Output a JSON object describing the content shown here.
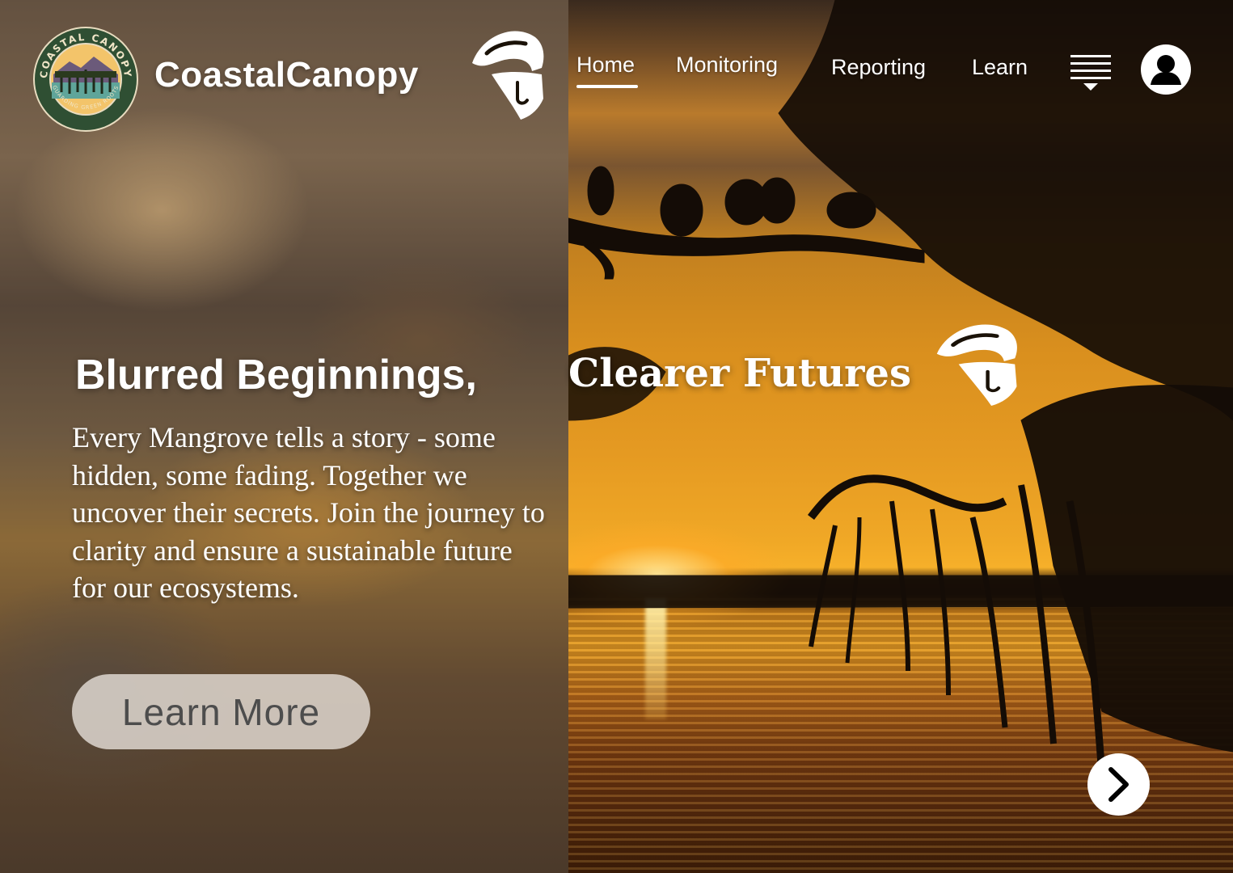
{
  "brand": {
    "name": "CoastalCanopy",
    "badge_top_text": "COASTAL CANOPY",
    "badge_bottom_text": "GUARDING GREEN ROOTS"
  },
  "nav": {
    "items": [
      {
        "label": "Home",
        "active": true
      },
      {
        "label": "Monitoring",
        "active": false
      },
      {
        "label": "Reporting",
        "active": false
      },
      {
        "label": "Learn",
        "active": false
      }
    ],
    "menu_icon": "hamburger-menu-icon",
    "profile_icon": "user-profile-icon"
  },
  "hero": {
    "title_left": "Blurred Beginnings,",
    "title_right": "Clearer Futures",
    "body": "Every Mangrove tells a story - some hidden, some fading. Together we uncover their secrets. Join the journey to clarity and ensure a sustainable future for our ecosystems.",
    "cta_label": "Learn More",
    "next_icon": "chevron-right-icon"
  },
  "colors": {
    "text": "#ffffff",
    "badge_green": "#2f4f33",
    "cta_bg": "#ebe4de",
    "cta_text": "#4d4d4d",
    "sunset_orange": "#e59a22"
  }
}
